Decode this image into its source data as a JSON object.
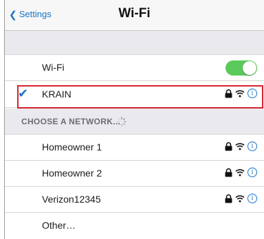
{
  "navbar": {
    "back_label": "Settings",
    "title": "Wi-Fi"
  },
  "wifi_toggle": {
    "label": "Wi-Fi",
    "on": true
  },
  "connected": {
    "name": "KRAIN"
  },
  "section": {
    "label": "CHOOSE A NETWORK..."
  },
  "networks": [
    {
      "name": "Homeowner 1"
    },
    {
      "name": "Homeowner 2"
    },
    {
      "name": "Verizon12345"
    }
  ],
  "other_label": "Other…",
  "colors": {
    "accent": "#1a73c9",
    "toggle_on": "#5cc95c",
    "highlight": "#d4232b"
  }
}
